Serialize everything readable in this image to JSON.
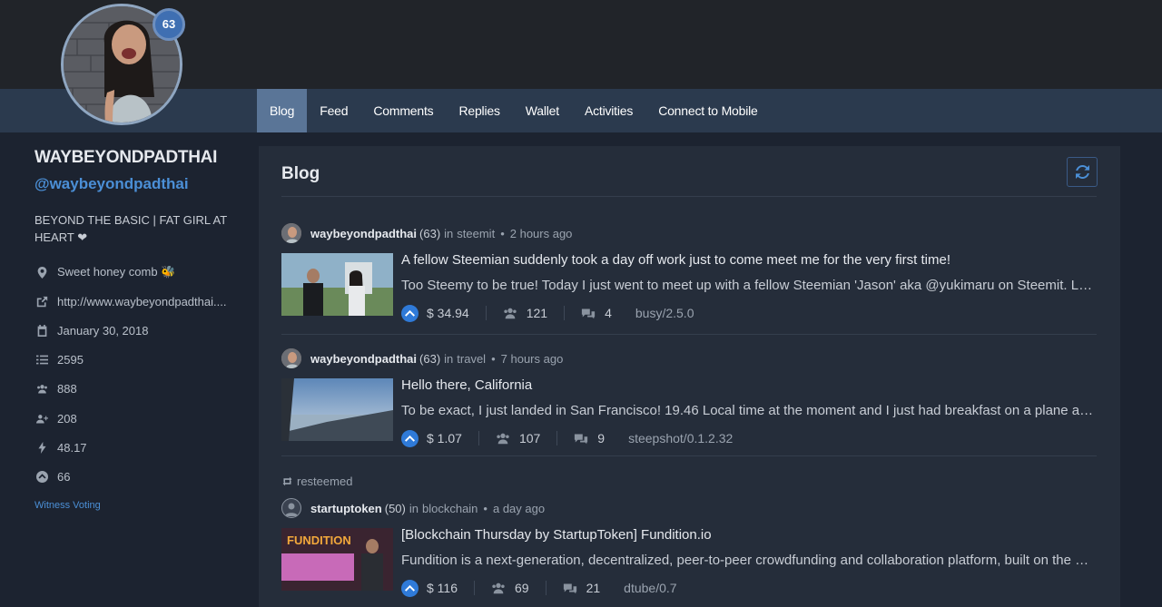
{
  "profile": {
    "reputation": "63",
    "display_name": "WAYBEYONDPADTHAI",
    "handle": "@waybeyondpadthai",
    "bio": "BEYOND THE BASIC | FAT GIRL AT HEART ❤",
    "location": "Sweet honey comb 🐝",
    "website": "http://www.waybeyondpadthai....",
    "joined": "January 30, 2018",
    "posts": "2595",
    "followers": "888",
    "following": "208",
    "voting_power": "48.17",
    "stat_66": "66",
    "witness_link": "Witness Voting"
  },
  "nav": {
    "items": [
      "Blog",
      "Feed",
      "Comments",
      "Replies",
      "Wallet",
      "Activities",
      "Connect to Mobile"
    ],
    "active": "Blog"
  },
  "main": {
    "title": "Blog",
    "resteemed_label": "resteemed"
  },
  "posts": [
    {
      "author": "waybeyondpadthai",
      "rep": "(63)",
      "in_label": "in",
      "category": "steemit",
      "time": "2 hours ago",
      "title": "A fellow Steemian suddenly took a day off work just to come meet me for the very first time!",
      "body": "Too Steemy to be true! Today I just went to meet up with a fellow Steemian 'Jason' aka @yukimaru on Steemit. Let me tell you about our day",
      "payout": "$ 34.94",
      "votes": "121",
      "comments": "4",
      "app": "busy/2.5.0"
    },
    {
      "author": "waybeyondpadthai",
      "rep": "(63)",
      "in_label": "in",
      "category": "travel",
      "time": "7 hours ago",
      "title": "Hello there, California",
      "body": "To be exact, I just landed in San Francisco! 19.46 Local time at the moment and I just had breakfast on a plane a few hours ago",
      "payout": "$ 1.07",
      "votes": "107",
      "comments": "9",
      "app": "steepshot/0.1.2.32"
    },
    {
      "author": "startuptoken",
      "rep": "(50)",
      "in_label": "in",
      "category": "blockchain",
      "time": "a day ago",
      "title": "[Blockchain Thursday by StartupToken] Fundition.io",
      "body": "Fundition is a next-generation, decentralized, peer-to-peer crowdfunding and collaboration platform, built on the Steem blockchain",
      "payout": "$ 116",
      "votes": "69",
      "comments": "21",
      "app": "dtube/0.7",
      "thumb_text": "FUNDITION"
    }
  ],
  "colors": {
    "accent": "#4b8fd6",
    "nav_bg": "#2b3a4e",
    "nav_active": "#5a7597",
    "card_bg": "#252d3a",
    "page_bg": "#1c2330"
  }
}
